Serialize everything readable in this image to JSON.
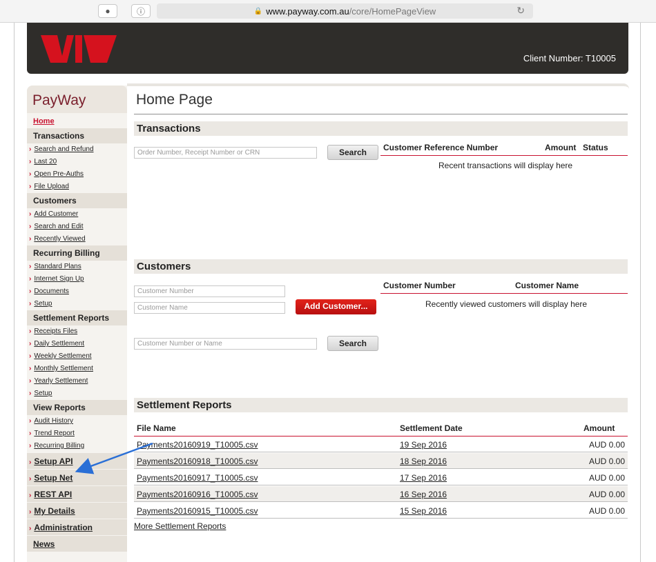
{
  "browser": {
    "url_domain": "www.payway.com.au",
    "url_path": "/core/HomePageView"
  },
  "header": {
    "client_number": "Client Number: T10005"
  },
  "sidebar": {
    "brand": "PayWay",
    "home": "Home",
    "sections": [
      {
        "title": "Transactions",
        "items": [
          "Search and Refund",
          "Last 20",
          "Open Pre-Auths",
          "File Upload"
        ]
      },
      {
        "title": "Customers",
        "items": [
          "Add Customer",
          "Search and Edit",
          "Recently Viewed"
        ]
      },
      {
        "title": "Recurring Billing",
        "items": [
          "Standard Plans",
          "Internet Sign Up",
          "Documents",
          "Setup"
        ]
      },
      {
        "title": "Settlement Reports",
        "items": [
          "Receipts Files",
          "Daily Settlement",
          "Weekly Settlement",
          "Monthly Settlement",
          "Yearly Settlement",
          "Setup"
        ]
      },
      {
        "title": "View Reports",
        "items": [
          "Audit History",
          "Trend Report",
          "Recurring Billing"
        ]
      }
    ],
    "big_items": [
      "Setup API",
      "Setup Net",
      "REST API",
      "My Details",
      "Administration"
    ],
    "news": "News",
    "chevron": "›"
  },
  "main": {
    "title": "Home Page",
    "transactions": {
      "heading": "Transactions",
      "search_placeholder": "Order Number, Receipt Number or CRN",
      "search_button": "Search",
      "col_crn": "Customer Reference Number",
      "col_amount": "Amount",
      "col_status": "Status",
      "empty_message": "Recent transactions will display here"
    },
    "customers": {
      "heading": "Customers",
      "number_placeholder": "Customer Number",
      "name_placeholder": "Customer Name",
      "add_button": "Add Customer...",
      "search_placeholder": "Customer Number or Name",
      "search_button": "Search",
      "col_number": "Customer Number",
      "col_name": "Customer Name",
      "empty_message": "Recently viewed customers will display here"
    },
    "settlement": {
      "heading": "Settlement Reports",
      "col_file": "File Name",
      "col_date": "Settlement Date",
      "col_amount": "Amount",
      "rows": [
        {
          "file": "Payments20160919_T10005.csv",
          "date": "19 Sep 2016",
          "amount": "AUD 0.00"
        },
        {
          "file": "Payments20160918_T10005.csv",
          "date": "18 Sep 2016",
          "amount": "AUD 0.00"
        },
        {
          "file": "Payments20160917_T10005.csv",
          "date": "17 Sep 2016",
          "amount": "AUD 0.00"
        },
        {
          "file": "Payments20160916_T10005.csv",
          "date": "16 Sep 2016",
          "amount": "AUD 0.00"
        },
        {
          "file": "Payments20160915_T10005.csv",
          "date": "15 Sep 2016",
          "amount": "AUD 0.00"
        }
      ],
      "more_link": "More Settlement Reports"
    }
  },
  "colors": {
    "brand_red": "#c8102e",
    "header_dark": "#2f2d2a",
    "annotation_arrow": "#2a6fd6"
  }
}
